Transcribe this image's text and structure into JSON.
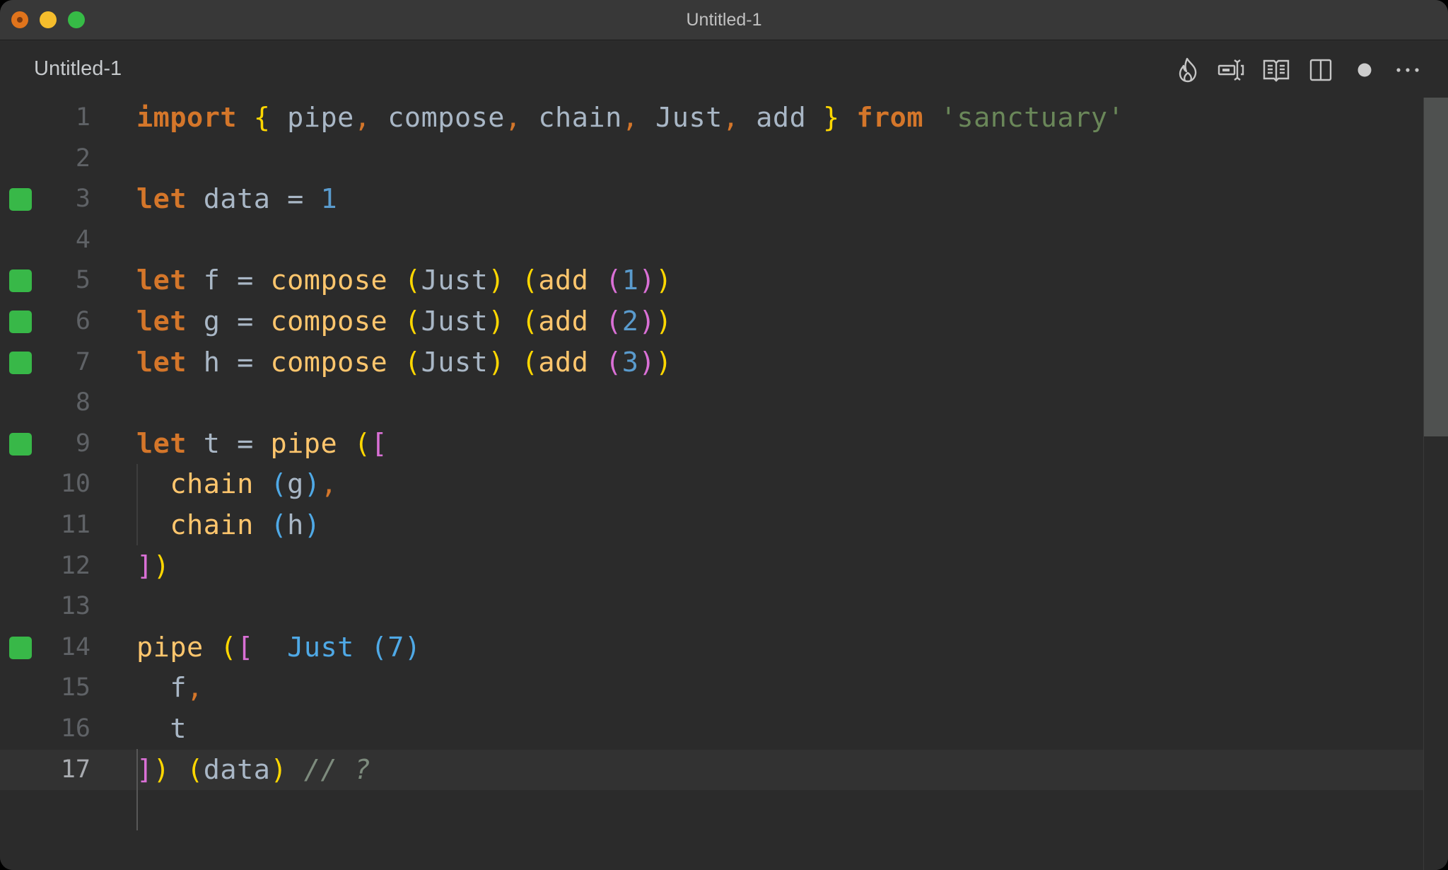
{
  "window": {
    "title": "Untitled-1"
  },
  "tab": {
    "label": "Untitled-1",
    "dirty_indicator": "●"
  },
  "toolbar": {
    "icons": [
      "flame-icon",
      "input-cursor-icon",
      "open-preview-icon",
      "split-editor-icon",
      "unsaved-dot-icon",
      "more-actions-icon"
    ]
  },
  "colors": {
    "keyword": "#d4762a",
    "function": "#ffc66d",
    "variable": "#a9b7c6",
    "number": "#5a9bcd",
    "string": "#6a8759",
    "comment": "#7d8b7d",
    "bracket_level1": "#ffd700",
    "bracket_level2": "#da70d6",
    "bracket_level3": "#4fa9e6",
    "coverage_marker": "#38b848",
    "background": "#2b2b2b"
  },
  "editor": {
    "current_line": 17,
    "lines": [
      {
        "n": "1",
        "mark": false,
        "tokens": [
          {
            "t": "import",
            "c": "kw"
          },
          {
            "t": " ",
            "c": "var"
          },
          {
            "t": "{",
            "c": "b1"
          },
          {
            "t": " pipe",
            "c": "var"
          },
          {
            "t": ",",
            "c": "punc"
          },
          {
            "t": " compose",
            "c": "var"
          },
          {
            "t": ",",
            "c": "punc"
          },
          {
            "t": " chain",
            "c": "var"
          },
          {
            "t": ",",
            "c": "punc"
          },
          {
            "t": " Just",
            "c": "var"
          },
          {
            "t": ",",
            "c": "punc"
          },
          {
            "t": " add ",
            "c": "var"
          },
          {
            "t": "}",
            "c": "b1"
          },
          {
            "t": " ",
            "c": "var"
          },
          {
            "t": "from",
            "c": "kw"
          },
          {
            "t": " ",
            "c": "var"
          },
          {
            "t": "'sanctuary'",
            "c": "str"
          }
        ]
      },
      {
        "n": "2",
        "mark": false,
        "tokens": []
      },
      {
        "n": "3",
        "mark": true,
        "tokens": [
          {
            "t": "let",
            "c": "kw"
          },
          {
            "t": " data = ",
            "c": "var"
          },
          {
            "t": "1",
            "c": "num"
          }
        ]
      },
      {
        "n": "4",
        "mark": false,
        "tokens": []
      },
      {
        "n": "5",
        "mark": true,
        "tokens": [
          {
            "t": "let",
            "c": "kw"
          },
          {
            "t": " f = ",
            "c": "var"
          },
          {
            "t": "compose",
            "c": "fn"
          },
          {
            "t": " ",
            "c": "var"
          },
          {
            "t": "(",
            "c": "b1"
          },
          {
            "t": "Just",
            "c": "var"
          },
          {
            "t": ")",
            "c": "b1"
          },
          {
            "t": " ",
            "c": "var"
          },
          {
            "t": "(",
            "c": "b1"
          },
          {
            "t": "add",
            "c": "fn"
          },
          {
            "t": " ",
            "c": "var"
          },
          {
            "t": "(",
            "c": "b2"
          },
          {
            "t": "1",
            "c": "num"
          },
          {
            "t": ")",
            "c": "b2"
          },
          {
            "t": ")",
            "c": "b1"
          }
        ]
      },
      {
        "n": "6",
        "mark": true,
        "tokens": [
          {
            "t": "let",
            "c": "kw"
          },
          {
            "t": " g = ",
            "c": "var"
          },
          {
            "t": "compose",
            "c": "fn"
          },
          {
            "t": " ",
            "c": "var"
          },
          {
            "t": "(",
            "c": "b1"
          },
          {
            "t": "Just",
            "c": "var"
          },
          {
            "t": ")",
            "c": "b1"
          },
          {
            "t": " ",
            "c": "var"
          },
          {
            "t": "(",
            "c": "b1"
          },
          {
            "t": "add",
            "c": "fn"
          },
          {
            "t": " ",
            "c": "var"
          },
          {
            "t": "(",
            "c": "b2"
          },
          {
            "t": "2",
            "c": "num"
          },
          {
            "t": ")",
            "c": "b2"
          },
          {
            "t": ")",
            "c": "b1"
          }
        ]
      },
      {
        "n": "7",
        "mark": true,
        "tokens": [
          {
            "t": "let",
            "c": "kw"
          },
          {
            "t": " h = ",
            "c": "var"
          },
          {
            "t": "compose",
            "c": "fn"
          },
          {
            "t": " ",
            "c": "var"
          },
          {
            "t": "(",
            "c": "b1"
          },
          {
            "t": "Just",
            "c": "var"
          },
          {
            "t": ")",
            "c": "b1"
          },
          {
            "t": " ",
            "c": "var"
          },
          {
            "t": "(",
            "c": "b1"
          },
          {
            "t": "add",
            "c": "fn"
          },
          {
            "t": " ",
            "c": "var"
          },
          {
            "t": "(",
            "c": "b2"
          },
          {
            "t": "3",
            "c": "num"
          },
          {
            "t": ")",
            "c": "b2"
          },
          {
            "t": ")",
            "c": "b1"
          }
        ]
      },
      {
        "n": "8",
        "mark": false,
        "tokens": []
      },
      {
        "n": "9",
        "mark": true,
        "tokens": [
          {
            "t": "let",
            "c": "kw"
          },
          {
            "t": " t = ",
            "c": "var"
          },
          {
            "t": "pipe",
            "c": "fn"
          },
          {
            "t": " ",
            "c": "var"
          },
          {
            "t": "(",
            "c": "b1"
          },
          {
            "t": "[",
            "c": "b2"
          }
        ]
      },
      {
        "n": "10",
        "mark": false,
        "tokens": [
          {
            "t": "  ",
            "c": "var"
          },
          {
            "t": "chain",
            "c": "fn"
          },
          {
            "t": " ",
            "c": "var"
          },
          {
            "t": "(",
            "c": "b3"
          },
          {
            "t": "g",
            "c": "var"
          },
          {
            "t": ")",
            "c": "b3"
          },
          {
            "t": ",",
            "c": "punc"
          }
        ]
      },
      {
        "n": "11",
        "mark": false,
        "tokens": [
          {
            "t": "  ",
            "c": "var"
          },
          {
            "t": "chain",
            "c": "fn"
          },
          {
            "t": " ",
            "c": "var"
          },
          {
            "t": "(",
            "c": "b3"
          },
          {
            "t": "h",
            "c": "var"
          },
          {
            "t": ")",
            "c": "b3"
          }
        ]
      },
      {
        "n": "12",
        "mark": false,
        "tokens": [
          {
            "t": "]",
            "c": "b2"
          },
          {
            "t": ")",
            "c": "b1"
          }
        ]
      },
      {
        "n": "13",
        "mark": false,
        "tokens": []
      },
      {
        "n": "14",
        "mark": true,
        "tokens": [
          {
            "t": "pipe",
            "c": "fn"
          },
          {
            "t": " ",
            "c": "var"
          },
          {
            "t": "(",
            "c": "b1"
          },
          {
            "t": "[",
            "c": "b2"
          },
          {
            "t": "  ",
            "c": "var"
          },
          {
            "t": "Just (7)",
            "c": "inline-val"
          }
        ]
      },
      {
        "n": "15",
        "mark": false,
        "tokens": [
          {
            "t": "  f",
            "c": "var"
          },
          {
            "t": ",",
            "c": "punc"
          }
        ]
      },
      {
        "n": "16",
        "mark": false,
        "tokens": [
          {
            "t": "  t",
            "c": "var"
          }
        ]
      },
      {
        "n": "17",
        "mark": false,
        "tokens": [
          {
            "t": "]",
            "c": "b2"
          },
          {
            "t": ")",
            "c": "b1"
          },
          {
            "t": " ",
            "c": "var"
          },
          {
            "t": "(",
            "c": "b1"
          },
          {
            "t": "data",
            "c": "var"
          },
          {
            "t": ")",
            "c": "b1"
          },
          {
            "t": " ",
            "c": "var"
          },
          {
            "t": "// ?",
            "c": "cmt"
          }
        ]
      }
    ],
    "inline_result": "Just (7)"
  }
}
